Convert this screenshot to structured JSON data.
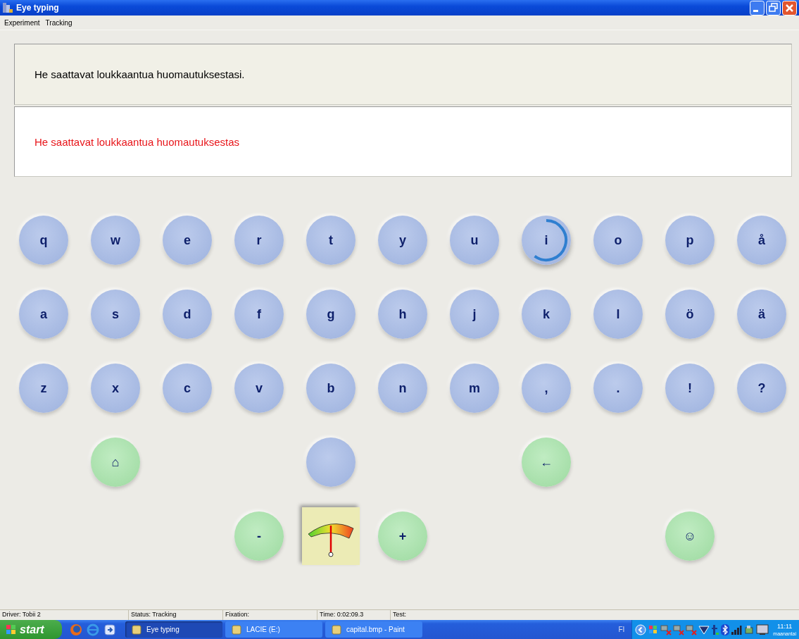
{
  "window": {
    "title": "Eye typing"
  },
  "menu": [
    "Experiment",
    "Tracking"
  ],
  "prompt": {
    "target": "He saattavat loukkaantua huomautuksestasi.",
    "typed": "He saattavat loukkaantua huomautuksestas"
  },
  "key_rows": [
    [
      {
        "kind": "letter",
        "label": "q",
        "focused": false
      },
      {
        "kind": "letter",
        "label": "w",
        "focused": false
      },
      {
        "kind": "letter",
        "label": "e",
        "focused": false
      },
      {
        "kind": "letter",
        "label": "r",
        "focused": false
      },
      {
        "kind": "letter",
        "label": "t",
        "focused": false
      },
      {
        "kind": "letter",
        "label": "y",
        "focused": false
      },
      {
        "kind": "letter",
        "label": "u",
        "focused": false
      },
      {
        "kind": "letter",
        "label": "i",
        "focused": true
      },
      {
        "kind": "letter",
        "label": "o",
        "focused": false
      },
      {
        "kind": "letter",
        "label": "p",
        "focused": false
      },
      {
        "kind": "letter",
        "label": "å",
        "focused": false
      }
    ],
    [
      {
        "kind": "letter",
        "label": "a",
        "focused": false
      },
      {
        "kind": "letter",
        "label": "s",
        "focused": false
      },
      {
        "kind": "letter",
        "label": "d",
        "focused": false
      },
      {
        "kind": "letter",
        "label": "f",
        "focused": false
      },
      {
        "kind": "letter",
        "label": "g",
        "focused": false
      },
      {
        "kind": "letter",
        "label": "h",
        "focused": false
      },
      {
        "kind": "letter",
        "label": "j",
        "focused": false
      },
      {
        "kind": "letter",
        "label": "k",
        "focused": false
      },
      {
        "kind": "letter",
        "label": "l",
        "focused": false
      },
      {
        "kind": "letter",
        "label": "ö",
        "focused": false
      },
      {
        "kind": "letter",
        "label": "ä",
        "focused": false
      }
    ],
    [
      {
        "kind": "letter",
        "label": "z",
        "focused": false
      },
      {
        "kind": "letter",
        "label": "x",
        "focused": false
      },
      {
        "kind": "letter",
        "label": "c",
        "focused": false
      },
      {
        "kind": "letter",
        "label": "v",
        "focused": false
      },
      {
        "kind": "letter",
        "label": "b",
        "focused": false
      },
      {
        "kind": "letter",
        "label": "n",
        "focused": false
      },
      {
        "kind": "letter",
        "label": "m",
        "focused": false
      },
      {
        "kind": "letter",
        "label": ",",
        "focused": false
      },
      {
        "kind": "letter",
        "label": ".",
        "focused": false
      },
      {
        "kind": "letter",
        "label": "!",
        "focused": false
      },
      {
        "kind": "letter",
        "label": "?",
        "focused": false
      }
    ],
    [
      {
        "kind": "command",
        "label": "⌂",
        "focused": false
      },
      {
        "kind": "letter",
        "focused": false
      },
      {
        "kind": "command",
        "label": "←",
        "focused": false
      }
    ],
    [
      {
        "kind": "command",
        "label": "-",
        "focused": false
      },
      {
        "kind": "meter"
      },
      {
        "kind": "command",
        "label": "+",
        "focused": false
      },
      {
        "kind": "command",
        "label": "☺",
        "focused": false
      }
    ]
  ],
  "status_bar": [
    "Driver: Tobii 2",
    "Status: Tracking",
    "Fixation:",
    "Time: 0:02:09.3",
    "Test:"
  ],
  "taskbar": {
    "start": "start",
    "tasks": [
      {
        "label": "Eye typing",
        "selected": true
      },
      {
        "label": "LACIE (E:)",
        "selected": false
      },
      {
        "label": "capital.bmp - Paint",
        "selected": false
      }
    ],
    "language": "FI",
    "clock": "11:11",
    "day": "maanantai"
  }
}
